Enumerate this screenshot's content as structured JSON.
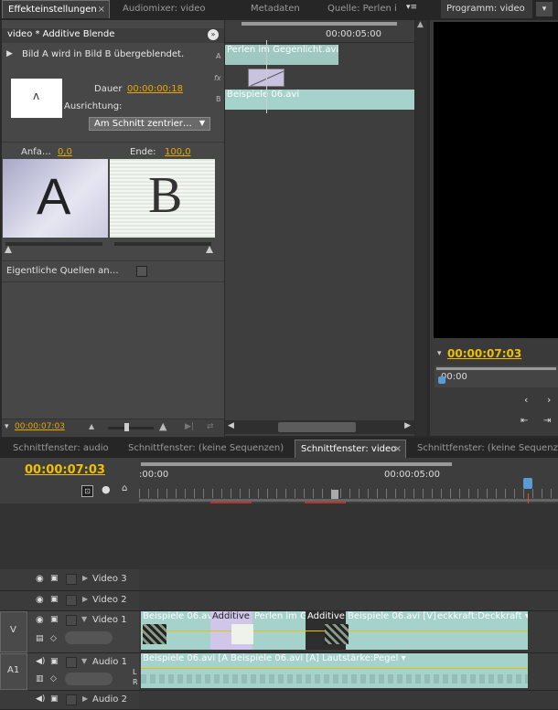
{
  "tabs_top": {
    "effect_controls": "Effekteinstellungen",
    "audio_mixer": "Audiomixer: video",
    "metadata": "Metadaten",
    "source": "Quelle: Perlen i",
    "program": "Programm: video"
  },
  "effect": {
    "title": "video * Additive Blende",
    "description": "Bild A wird in Bild B übergeblendet.",
    "duration_label": "Dauer",
    "duration_value": "00:00:00:18",
    "alignment_label": "Ausrichtung:",
    "alignment_value": "Am Schnitt zentrier…",
    "start_label": "Anfa…",
    "start_value": "0,0",
    "end_label": "Ende:",
    "end_value": "100,0",
    "preview_a": "A",
    "preview_b": "B",
    "actual_sources_label": "Eigentliche Quellen an…",
    "fx_label": "fx",
    "track_a_label": "A",
    "track_b_label": "B",
    "mini_time": "00:00:05:00",
    "clip_a": "Perlen im Gegenlicht.avi",
    "clip_b": "Beispiele 06.avi",
    "bottom_timecode": "00:00:07:03"
  },
  "program": {
    "timecode": "00:00:07:03",
    "ruler_start": "00:00"
  },
  "tabs_bottom": {
    "seq_audio": "Schnittfenster: audio",
    "seq_none": "Schnittfenster: (keine Sequenzen)",
    "seq_video": "Schnittfenster: video",
    "seq_none2": "Schnittfenster: (keine Sequenze"
  },
  "timeline": {
    "timecode": "00:00:07:03",
    "ruler_start": ":00:00",
    "ruler_mid": "00:00:05:00",
    "tracks": {
      "video3": "Video 3",
      "video2": "Video 2",
      "video1": "Video 1",
      "audio1": "Audio 1",
      "audio2": "Audio 2",
      "v_target": "V",
      "a1_target": "A1",
      "l": "L",
      "r": "R"
    },
    "video_clips": {
      "c1": "Beispiele 06.av",
      "c2": "Additive",
      "c3": "Perlen im G",
      "c4": "Additive",
      "c5": "Beispiele 06.avi [V]",
      "c6": "eckkraft:Deckkraft ▾"
    },
    "audio_clips": {
      "c1": "Beispiele 06.avi [A",
      "c2": "Beispiele 06.avi [A]",
      "c3": "Lautstärke:Pegel ▾"
    }
  }
}
